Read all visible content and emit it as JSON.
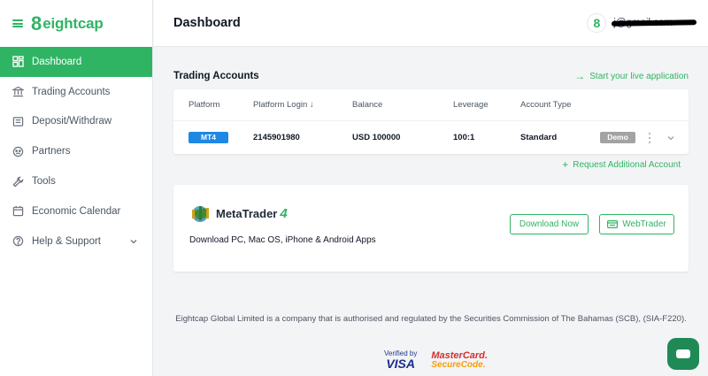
{
  "brand": {
    "logo_mark": "8",
    "name": "eightcap",
    "accent": "#2fb463"
  },
  "sidebar": {
    "items": [
      {
        "label": "Dashboard",
        "icon": "dashboard-icon",
        "active": true
      },
      {
        "label": "Trading Accounts",
        "icon": "bank-icon"
      },
      {
        "label": "Deposit/Withdraw",
        "icon": "wallet-icon"
      },
      {
        "label": "Partners",
        "icon": "partners-icon"
      },
      {
        "label": "Tools",
        "icon": "wrench-icon"
      },
      {
        "label": "Economic Calendar",
        "icon": "calendar-icon"
      },
      {
        "label": "Help & Support",
        "icon": "help-icon",
        "has_chevron": true
      }
    ]
  },
  "header": {
    "title": "Dashboard",
    "user_avatar": "8",
    "user_email": "j@gmail.com"
  },
  "accounts": {
    "title": "Trading Accounts",
    "start_live_label": "Start your live application",
    "columns": [
      "Platform",
      "Platform Login",
      "Balance",
      "Leverage",
      "Account Type"
    ],
    "sort_indicator": "↓",
    "rows": [
      {
        "platform": "MT4",
        "login": "2145901980",
        "balance": "USD 100000",
        "leverage": "100:1",
        "account_type": "Standard",
        "status": "Demo"
      }
    ],
    "request_label": "Request Additional Account",
    "platform_color": "#1e88e5",
    "demo_color": "#a3a3a3"
  },
  "metatrader": {
    "logo_text": "MetaTrader",
    "logo_version": "4",
    "subtitle": "Download PC, Mac OS, iPhone & Android Apps",
    "download_label": "Download Now",
    "webtrader_label": "WebTrader"
  },
  "footer": {
    "text": "Eightcap Global Limited is a company that is authorised and regulated by the Securities Commission of The Bahamas (SCB), (SIA-F220).",
    "visa_by": "Verified by",
    "visa": "VISA",
    "mastercard": "MasterCard.",
    "securecode": "SecureCode."
  }
}
